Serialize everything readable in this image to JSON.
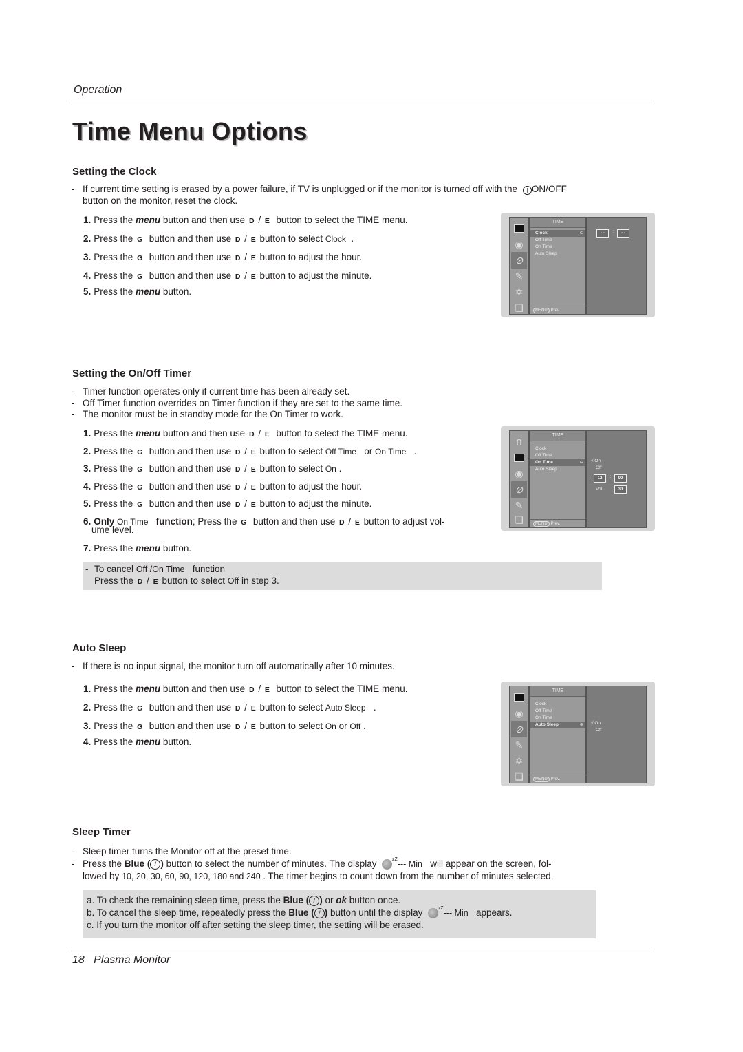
{
  "header": {
    "section": "Operation",
    "title": "Time Menu Options"
  },
  "keys": {
    "up": "D",
    "down": "E",
    "right": "G",
    "menu": "menu",
    "ok": "ok",
    "blue": "Blue"
  },
  "clock": {
    "heading": "Setting the Clock",
    "bullet_line1_pre": "If current time setting is erased by a power failure, if TV is unplugged or if the monitor is turned off with the",
    "power_label": "ON/OFF",
    "bullet_line2": "button on the monitor, reset the clock.",
    "steps": [
      {
        "n": "1.",
        "pre": "Press the",
        "mid": "button and then use",
        "post": "button to select the TIME menu."
      },
      {
        "n": "2.",
        "pre": "Press the",
        "mid": "button and then use",
        "post": "button to select",
        "osd": "Clock",
        "end": "."
      },
      {
        "n": "3.",
        "pre": "Press the",
        "mid": "button and then use",
        "post": "button to adjust the hour."
      },
      {
        "n": "4.",
        "pre": "Press the",
        "mid": "button and then use",
        "post": "button to adjust the minute."
      },
      {
        "n": "5.",
        "pre": "Press the",
        "post": "button."
      }
    ],
    "osd_menu": {
      "title": "TIME",
      "items": [
        "Clock",
        "Off Time",
        "On Time",
        "Auto Sleep"
      ],
      "selected": "Clock",
      "prev_key": "MENU",
      "prev_label": "Prev.",
      "hour": "- -",
      "minute": "- -",
      "colon": ":"
    }
  },
  "timer": {
    "heading": "Setting the On/Off Timer",
    "bullets": [
      "Timer function operates only if current time has been already set.",
      "Off Timer function overrides on Timer function if they are set to the same time.",
      "The monitor must be in standby mode for the On Timer to work."
    ],
    "steps": [
      {
        "n": "1.",
        "pre": "Press the",
        "mid": "button and then use",
        "post": "button to select the TIME menu."
      },
      {
        "n": "2.",
        "pre": "Press the",
        "mid": "button and then use",
        "post": "button to select",
        "osd": "Off Time",
        "or": "or",
        "osd2": "On Time",
        "end": "."
      },
      {
        "n": "3.",
        "pre": "Press the",
        "mid": "button and then use",
        "post": "button to select",
        "osd": "On",
        "end": "."
      },
      {
        "n": "4.",
        "pre": "Press the",
        "mid": "button and then use",
        "post": "button to adjust the hour."
      },
      {
        "n": "5.",
        "pre": "Press the",
        "mid": "button and then use",
        "post": "button to adjust the minute."
      },
      {
        "n": "6.",
        "only": "Only",
        "osd": "On Time",
        "func": "function",
        "pre": "; Press the",
        "mid": "button and then use",
        "post": "button to adjust vol-",
        "cont": "ume level."
      },
      {
        "n": "7.",
        "pre": "Press the",
        "post": "button."
      }
    ],
    "note": {
      "line1_pre": "To cancel",
      "line1_osd": "Off /On Time",
      "line1_post": "function",
      "line2_pre": "Press the",
      "line2_post": "button to select",
      "line2_osd": "Off",
      "line2_end": "in step 3."
    },
    "osd_menu": {
      "title": "TIME",
      "items": [
        "Clock",
        "Off Time",
        "On Time",
        "Auto Sleep"
      ],
      "selected": "On Time",
      "opt_on": "On",
      "opt_off": "Off",
      "check": "√",
      "hour": "12",
      "minute": "00",
      "colon": ":",
      "vol_label": "Vol.",
      "vol_value": "30",
      "prev_key": "MENU",
      "prev_label": "Prev."
    }
  },
  "autosleep": {
    "heading": "Auto Sleep",
    "bullet": "If there is no input signal, the monitor turn off automatically after 10 minutes.",
    "steps": [
      {
        "n": "1.",
        "pre": "Press the",
        "mid": "button and then use",
        "post": "button to select the TIME menu."
      },
      {
        "n": "2.",
        "pre": "Press the",
        "mid": "button and then use",
        "post": "button to select",
        "osd": "Auto Sleep",
        "end": "."
      },
      {
        "n": "3.",
        "pre": "Press the",
        "mid": "button and then use",
        "post": "button to select",
        "osd": "On",
        "or": "or",
        "osd2": "Off",
        "end": "."
      },
      {
        "n": "4.",
        "pre": "Press the",
        "post": "button."
      }
    ],
    "osd_menu": {
      "title": "TIME",
      "items": [
        "Clock",
        "Off Time",
        "On Time",
        "Auto Sleep"
      ],
      "selected": "Auto Sleep",
      "opt_on": "On",
      "opt_off": "Off",
      "check": "√",
      "prev_key": "MENU",
      "prev_label": "Prev."
    }
  },
  "sleep": {
    "heading": "Sleep Timer",
    "bullet1": "Sleep timer turns the Monitor off at the preset time.",
    "bullet2_pre": "Press the",
    "bullet2_mid": "button to select the number of minutes. The display",
    "display_text": "--- Min",
    "bullet2_post": "will appear on the screen, fol-",
    "bullet3_pre": "lowed by",
    "minutes": [
      "10",
      "20",
      "30",
      "60",
      "90",
      "120",
      "180",
      "240"
    ],
    "bullet3_post": ". The timer begins to count down from the number of minutes selected.",
    "notes": {
      "a_pre": "a. To check the remaining sleep time, press the",
      "a_mid": "or",
      "a_post": "button once.",
      "b_pre": "b. To cancel the sleep time, repeatedly press the",
      "b_mid": "button until the display",
      "b_post": "appears.",
      "c": "c. If you turn the monitor off after setting the sleep timer, the setting will be erased."
    },
    "zz": "zZ"
  },
  "footer": {
    "page": "18",
    "product": "Plasma Monitor"
  }
}
